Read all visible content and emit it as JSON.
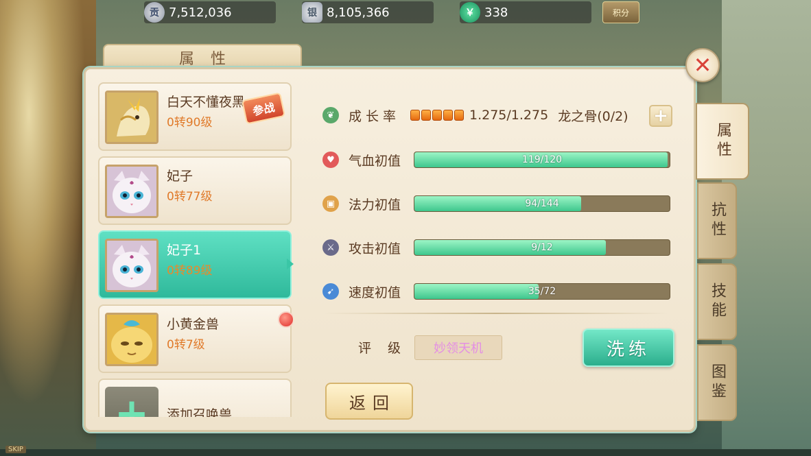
{
  "currency": [
    {
      "icon": "contribution-coin-icon",
      "icon_char": "贡",
      "value": "7,512,036"
    },
    {
      "icon": "silver-ingot-icon",
      "icon_char": "银",
      "value": "8,105,366"
    },
    {
      "icon": "jade-coin-icon",
      "icon_char": "￥",
      "value": "338"
    }
  ],
  "score_button_label": "积分",
  "panel_title": "属性",
  "pets": [
    {
      "name": "白天不懂夜黑",
      "level": "0转90级",
      "badge": "参战",
      "selected": false
    },
    {
      "name": "妃子",
      "level": "0转77级",
      "selected": false
    },
    {
      "name": "妃子1",
      "level": "0转89级",
      "selected": true
    },
    {
      "name": "小黄金兽",
      "level": "0转7级",
      "selected": false,
      "notification": true
    },
    {
      "name": "添加召唤兽",
      "level": ""
    }
  ],
  "growth": {
    "label": "成长率",
    "stars": 5,
    "value": "1.275/1.275",
    "dragon_bone": "龙之骨(0/2)"
  },
  "stats": [
    {
      "label": "气血初值",
      "current": 119,
      "max": 120,
      "text": "119/120",
      "icon": "heart-icon",
      "color": "#e25a5a"
    },
    {
      "label": "法力初值",
      "current": 94,
      "max": 144,
      "text": "94/144",
      "icon": "mana-icon",
      "color": "#e0a24a"
    },
    {
      "label": "攻击初值",
      "current": 9,
      "max": 12,
      "text": "9/12",
      "icon": "sword-icon",
      "color": "#6a6a8a"
    },
    {
      "label": "速度初值",
      "current": 35,
      "max": 72,
      "text": "35/72",
      "icon": "speed-icon",
      "color": "#4a8ad6"
    }
  ],
  "rating": {
    "label": "评级",
    "value": "妙领天机"
  },
  "wash_button_label": "洗练",
  "back_button_label": "返回",
  "tabs": [
    {
      "label": "属性",
      "active": true
    },
    {
      "label": "抗性",
      "active": false
    },
    {
      "label": "技能",
      "active": false
    },
    {
      "label": "图鉴",
      "active": false
    }
  ],
  "skip_label": "SKIP"
}
